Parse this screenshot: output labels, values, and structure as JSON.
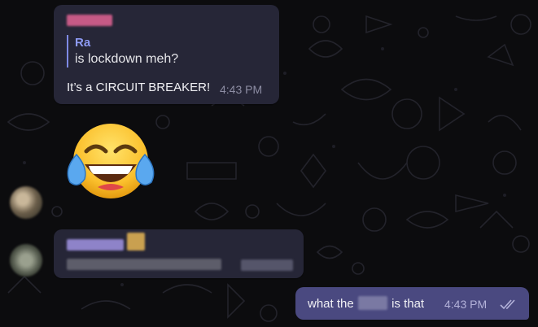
{
  "messages": [
    {
      "reply": {
        "name": "Ra",
        "text": "is lockdown meh?"
      },
      "text": "It’s a CIRCUIT BREAKER!",
      "time": "4:43 PM"
    },
    {
      "sticker": "face-with-tears-of-joy"
    },
    {
      "redacted": true
    },
    {
      "text_before": "what the",
      "text_after": "is that",
      "time": "4:43 PM",
      "read_receipt": "double-check-icon"
    }
  ],
  "colors": {
    "background": "#0c0c0e",
    "incoming_bubble": "#262637",
    "outgoing_bubble": "#4a4980",
    "reply_accent": "#8e9bf5"
  }
}
